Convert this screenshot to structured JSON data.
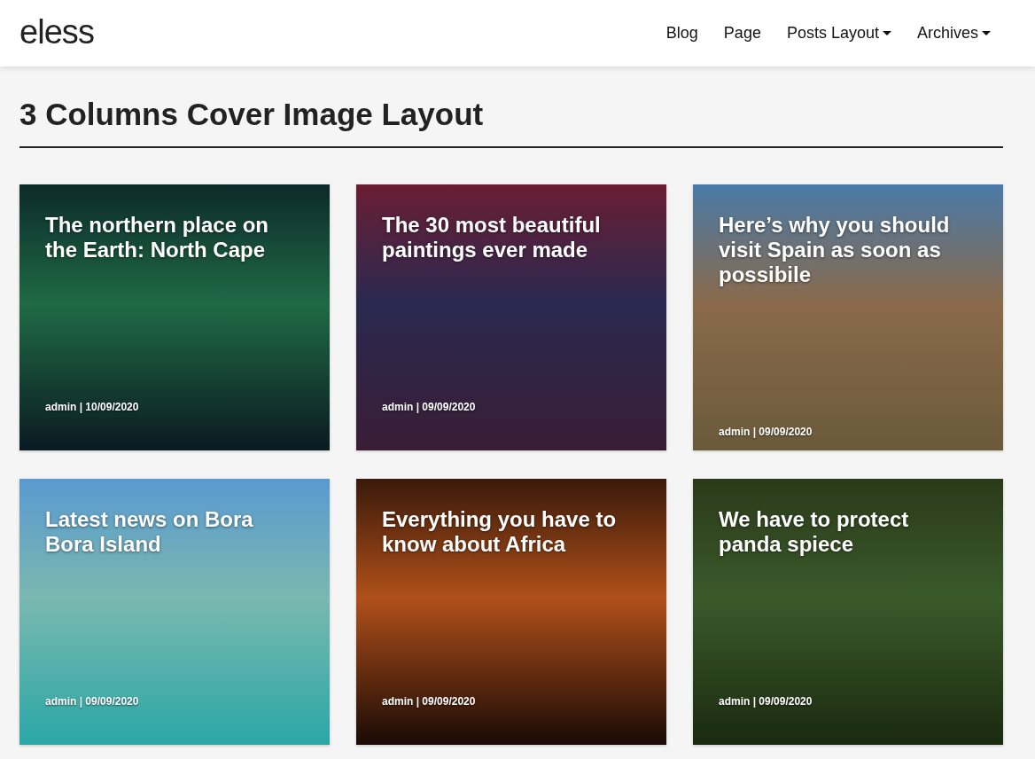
{
  "header": {
    "logo": "eless",
    "nav": [
      {
        "label": "Blog",
        "dropdown": false
      },
      {
        "label": "Page",
        "dropdown": false
      },
      {
        "label": "Posts Layout",
        "dropdown": true
      },
      {
        "label": "Archives",
        "dropdown": true
      }
    ]
  },
  "page_title": "3 Columns Cover Image Layout",
  "posts": [
    {
      "title": "The northern place on the Earth: North Cape",
      "meta": "admin | 10/09/2020"
    },
    {
      "title": "The 30 most beautiful paintings ever made",
      "meta": "admin | 09/09/2020"
    },
    {
      "title": "Here’s why you should visit Spain as soon as possibile",
      "meta": "admin | 09/09/2020"
    },
    {
      "title": "Latest news on Bora Bora Island",
      "meta": "admin | 09/09/2020"
    },
    {
      "title": "Everything you have to know about Africa",
      "meta": "admin | 09/09/2020"
    },
    {
      "title": "We have to protect panda spiece",
      "meta": "admin | 09/09/2020"
    }
  ]
}
